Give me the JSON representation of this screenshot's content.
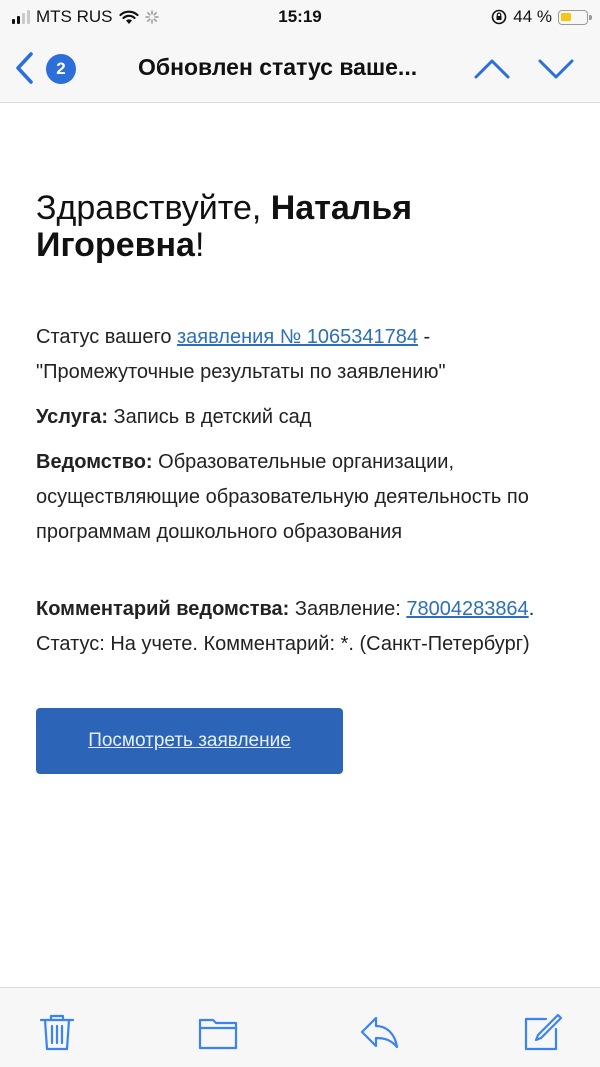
{
  "status_bar": {
    "carrier": "MTS RUS",
    "time": "15:19",
    "battery_percent": "44 %",
    "battery_level": 0.44
  },
  "nav": {
    "unread_count": "2",
    "title": "Обновлен статус ваше..."
  },
  "email": {
    "greeting_prefix": "Здравствуйте, ",
    "greeting_name": "Наталья Игоревна",
    "greeting_suffix": "!",
    "status_prefix": "Статус вашего ",
    "status_link": "заявления № 1065341784",
    "status_suffix": " - \"Промежуточные результаты по заявлению\"",
    "service_label": "Услуга:",
    "service_value": " Запись в детский сад",
    "dept_label": "Ведомство:",
    "dept_value": " Образовательные организации, осуществляющие образовательную деятельность по программам дошкольного образования",
    "comment_label": "Комментарий ведомства:",
    "comment_prefix": " Заявление: ",
    "comment_link": "78004283864",
    "comment_suffix": ". Статус: На учете. Комментарий: *. (Санкт-Петербург)",
    "button_label": "Посмотреть заявление"
  },
  "colors": {
    "accent": "#2d6fd9",
    "link": "#2d6fb8",
    "button": "#2c65b8",
    "icon": "#3b82f6"
  },
  "toolbar": {
    "icons": [
      "trash-icon",
      "folder-icon",
      "reply-icon",
      "compose-icon"
    ]
  }
}
